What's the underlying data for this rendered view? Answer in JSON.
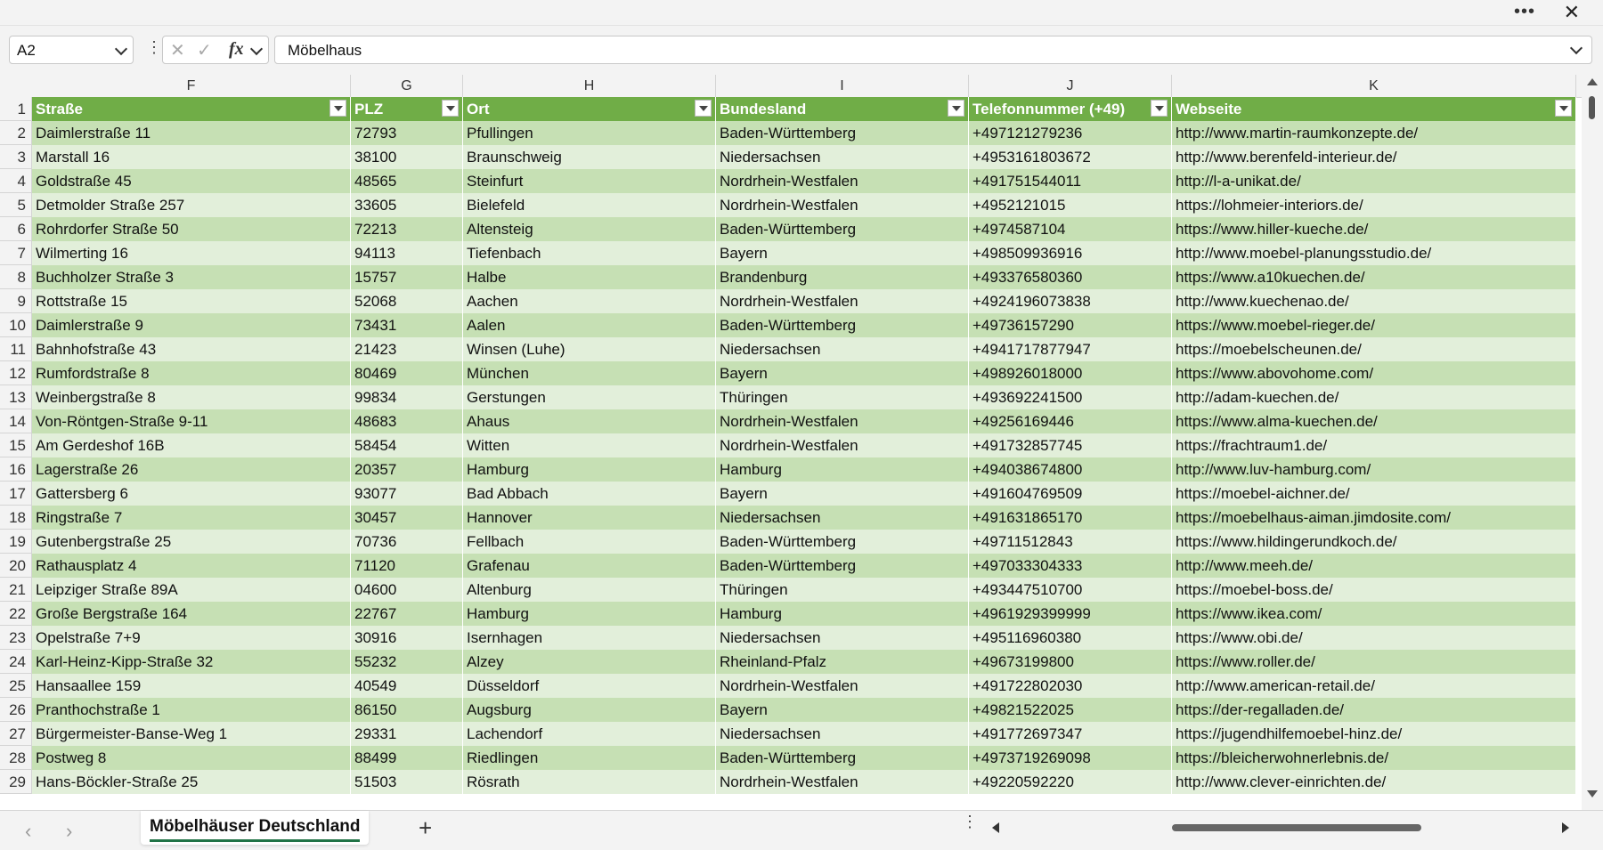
{
  "formula_bar": {
    "name_box": "A2",
    "fx_label": "fx",
    "formula_value": "Möbelhaus"
  },
  "columns": [
    "F",
    "G",
    "H",
    "I",
    "J",
    "K"
  ],
  "header_row_number": "1",
  "headers": [
    "Straße",
    "PLZ",
    "Ort",
    "Bundesland",
    "Telefonnummer (+49)",
    "Webseite"
  ],
  "rows": [
    {
      "n": "2",
      "cells": [
        "Daimlerstraße 11",
        "72793",
        "Pfullingen",
        "Baden-Württemberg",
        "+497121279236",
        "http://www.martin-raumkonzepte.de/"
      ]
    },
    {
      "n": "3",
      "cells": [
        "Marstall 16",
        "38100",
        "Braunschweig",
        "Niedersachsen",
        "+4953161803672",
        "http://www.berenfeld-interieur.de/"
      ]
    },
    {
      "n": "4",
      "cells": [
        "Goldstraße 45",
        "48565",
        "Steinfurt",
        "Nordrhein-Westfalen",
        "+491751544011",
        "http://l-a-unikat.de/"
      ]
    },
    {
      "n": "5",
      "cells": [
        "Detmolder Straße 257",
        "33605",
        "Bielefeld",
        "Nordrhein-Westfalen",
        "+4952121015",
        "https://lohmeier-interiors.de/"
      ]
    },
    {
      "n": "6",
      "cells": [
        "Rohrdorfer Straße 50",
        "72213",
        "Altensteig",
        "Baden-Württemberg",
        "+4974587104",
        "https://www.hiller-kueche.de/"
      ]
    },
    {
      "n": "7",
      "cells": [
        "Wilmerting 16",
        "94113",
        "Tiefenbach",
        "Bayern",
        "+498509936916",
        "http://www.moebel-planungsstudio.de/"
      ]
    },
    {
      "n": "8",
      "cells": [
        "Buchholzer Straße 3",
        "15757",
        "Halbe",
        "Brandenburg",
        "+493376580360",
        "https://www.a10kuechen.de/"
      ]
    },
    {
      "n": "9",
      "cells": [
        "Rottstraße 15",
        "52068",
        "Aachen",
        "Nordrhein-Westfalen",
        "+4924196073838",
        "http://www.kuechenao.de/"
      ]
    },
    {
      "n": "10",
      "cells": [
        "Daimlerstraße 9",
        "73431",
        "Aalen",
        "Baden-Württemberg",
        "+49736157290",
        "https://www.moebel-rieger.de/"
      ]
    },
    {
      "n": "11",
      "cells": [
        "Bahnhofstraße 43",
        "21423",
        "Winsen (Luhe)",
        "Niedersachsen",
        "+4941717877947",
        "https://moebelscheunen.de/"
      ]
    },
    {
      "n": "12",
      "cells": [
        "Rumfordstraße 8",
        "80469",
        "München",
        "Bayern",
        "+498926018000",
        "https://www.abovohome.com/"
      ]
    },
    {
      "n": "13",
      "cells": [
        "Weinbergstraße 8",
        "99834",
        "Gerstungen",
        "Thüringen",
        "+493692241500",
        "http://adam-kuechen.de/"
      ]
    },
    {
      "n": "14",
      "cells": [
        "Von-Röntgen-Straße 9-11",
        "48683",
        "Ahaus",
        "Nordrhein-Westfalen",
        "+49256169446",
        "https://www.alma-kuechen.de/"
      ]
    },
    {
      "n": "15",
      "cells": [
        "Am Gerdeshof 16B",
        "58454",
        "Witten",
        "Nordrhein-Westfalen",
        "+491732857745",
        "https://frachtraum1.de/"
      ]
    },
    {
      "n": "16",
      "cells": [
        "Lagerstraße 26",
        "20357",
        "Hamburg",
        "Hamburg",
        "+494038674800",
        "http://www.luv-hamburg.com/"
      ]
    },
    {
      "n": "17",
      "cells": [
        "Gattersberg 6",
        "93077",
        "Bad Abbach",
        "Bayern",
        "+491604769509",
        "https://moebel-aichner.de/"
      ]
    },
    {
      "n": "18",
      "cells": [
        "Ringstraße 7",
        "30457",
        "Hannover",
        "Niedersachsen",
        "+491631865170",
        "https://moebelhaus-aiman.jimdosite.com/"
      ]
    },
    {
      "n": "19",
      "cells": [
        "Gutenbergstraße 25",
        "70736",
        "Fellbach",
        "Baden-Württemberg",
        "+49711512843",
        "https://www.hildingerundkoch.de/"
      ]
    },
    {
      "n": "20",
      "cells": [
        "Rathausplatz 4",
        "71120",
        "Grafenau",
        "Baden-Württemberg",
        "+497033304333",
        "http://www.meeh.de/"
      ]
    },
    {
      "n": "21",
      "cells": [
        "Leipziger Straße 89A",
        "04600",
        "Altenburg",
        "Thüringen",
        "+493447510700",
        "https://moebel-boss.de/"
      ]
    },
    {
      "n": "22",
      "cells": [
        "Große Bergstraße 164",
        "22767",
        "Hamburg",
        "Hamburg",
        "+4961929399999",
        "https://www.ikea.com/"
      ]
    },
    {
      "n": "23",
      "cells": [
        "Opelstraße 7+9",
        "30916",
        "Isernhagen",
        "Niedersachsen",
        "+495116960380",
        "https://www.obi.de/"
      ]
    },
    {
      "n": "24",
      "cells": [
        "Karl-Heinz-Kipp-Straße 32",
        "55232",
        "Alzey",
        "Rheinland-Pfalz",
        "+49673199800",
        "https://www.roller.de/"
      ]
    },
    {
      "n": "25",
      "cells": [
        "Hansaallee 159",
        "40549",
        "Düsseldorf",
        "Nordrhein-Westfalen",
        "+491722802030",
        "http://www.american-retail.de/"
      ]
    },
    {
      "n": "26",
      "cells": [
        "Pranthochstraße 1",
        "86150",
        "Augsburg",
        "Bayern",
        "+49821522025",
        "https://der-regalladen.de/"
      ]
    },
    {
      "n": "27",
      "cells": [
        "Bürgermeister-Banse-Weg 1",
        "29331",
        "Lachendorf",
        "Niedersachsen",
        "+491772697347",
        "https://jugendhilfemoebel-hinz.de/"
      ]
    },
    {
      "n": "28",
      "cells": [
        "Postweg 8",
        "88499",
        "Riedlingen",
        "Baden-Württemberg",
        "+4973719269098",
        "https://bleicherwohnerlebnis.de/"
      ]
    },
    {
      "n": "29",
      "cells": [
        "Hans-Böckler-Straße 25",
        "51503",
        "Rösrath",
        "Nordrhein-Westfalen",
        "+49220592220",
        "http://www.clever-einrichten.de/"
      ]
    }
  ],
  "sheet_tab": "Möbelhäuser Deutschland",
  "icons": {
    "more": "more-icon",
    "close": "close-icon",
    "cancel": "cancel-icon",
    "confirm": "check-icon",
    "add_sheet": "plus-icon",
    "filter": "filter-dropdown-icon"
  },
  "colors": {
    "header_bg": "#70ad47",
    "band_dark": "#c6e0b4",
    "band_light": "#e2efda",
    "accent": "#217346"
  }
}
